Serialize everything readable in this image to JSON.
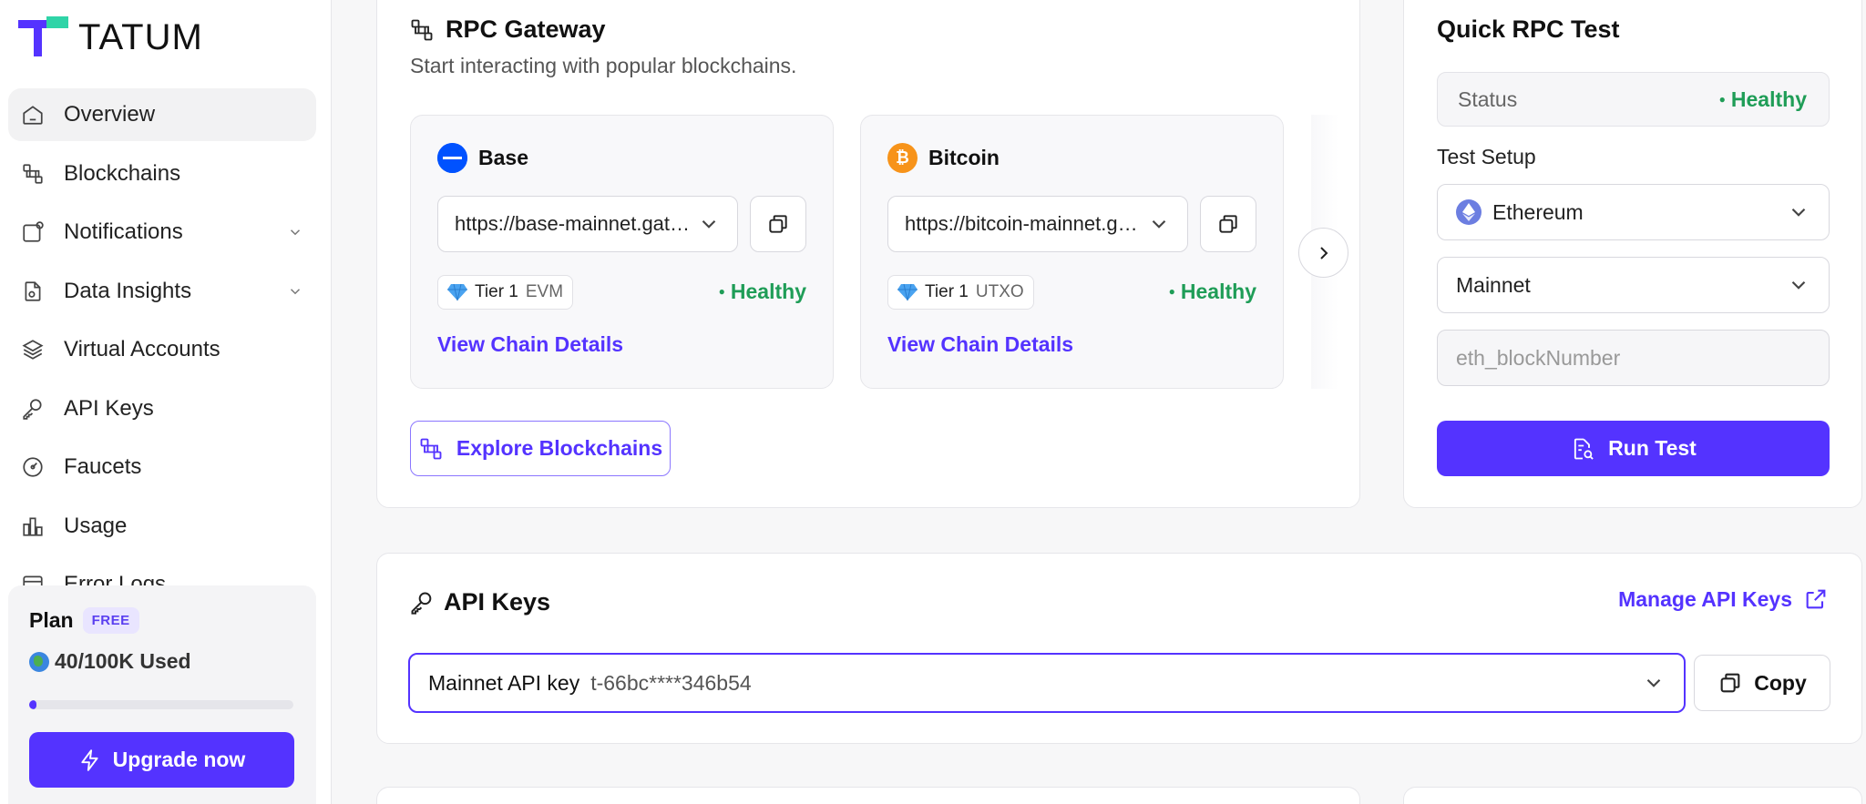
{
  "brand": {
    "name": "TATUM",
    "colors": {
      "accent": "#5433ff",
      "logo_teal": "#2fd4a7",
      "logo_purple": "#5433ff",
      "healthy": "#1f9d57"
    }
  },
  "sidebar": {
    "items": [
      {
        "label": "Overview",
        "icon": "home-icon",
        "active": true
      },
      {
        "label": "Blockchains",
        "icon": "blockchain-icon"
      },
      {
        "label": "Notifications",
        "icon": "notification-icon",
        "expandable": true
      },
      {
        "label": "Data Insights",
        "icon": "data-icon",
        "expandable": true
      },
      {
        "label": "Virtual Accounts",
        "icon": "layers-icon"
      },
      {
        "label": "API Keys",
        "icon": "key-icon"
      },
      {
        "label": "Faucets",
        "icon": "gauge-icon"
      },
      {
        "label": "Usage",
        "icon": "bar-chart-icon"
      },
      {
        "label": "Error Logs",
        "icon": "log-icon"
      }
    ]
  },
  "plan": {
    "title": "Plan",
    "badge": "FREE",
    "usage": "40/100K Used",
    "usage_fraction": 0.0004,
    "upgrade_label": "Upgrade now"
  },
  "rpc": {
    "title": "RPC Gateway",
    "subtitle": "Start interacting with popular blockchains.",
    "chains": [
      {
        "name": "Base",
        "url": "https://base-mainnet.gateway.tatum.io",
        "tier": "Tier 1",
        "kind": "EVM",
        "status": "Healthy",
        "link": "View Chain Details",
        "logo_color": "#0052ff"
      },
      {
        "name": "Bitcoin",
        "url": "https://bitcoin-mainnet.gateway.tatum.io",
        "tier": "Tier 1",
        "kind": "UTXO",
        "status": "Healthy",
        "link": "View Chain Details",
        "logo_color": "#f7931a"
      }
    ],
    "explore_label": "Explore Blockchains"
  },
  "quick_test": {
    "title": "Quick RPC Test",
    "status_key": "Status",
    "status_value": "Healthy",
    "setup_label": "Test Setup",
    "chain": "Ethereum",
    "network": "Mainnet",
    "method_placeholder": "eth_blockNumber",
    "run_label": "Run Test"
  },
  "api_keys": {
    "title": "API Keys",
    "manage_label": "Manage API Keys",
    "key_name": "Mainnet API key",
    "key_value": "t-66bc****346b54",
    "copy_label": "Copy"
  }
}
